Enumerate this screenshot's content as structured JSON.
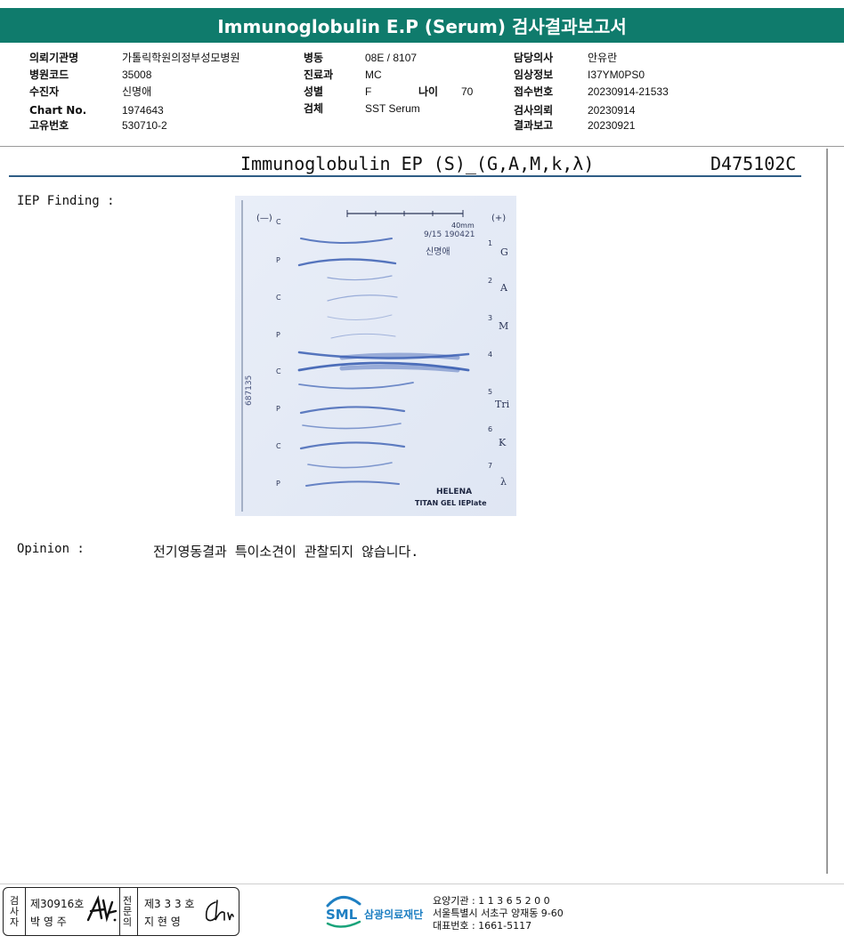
{
  "report": {
    "title": "Immunoglobulin E.P (Serum) 검사결과보고서"
  },
  "patient_info": {
    "col1": [
      {
        "label": "의뢰기관명",
        "value": "가톨릭학원의정부성모병원"
      },
      {
        "label": "병원코드",
        "value": "35008"
      },
      {
        "label": "수진자",
        "value": "신명애"
      },
      {
        "label": "Chart No.",
        "value": "1974643"
      },
      {
        "label": "고유번호",
        "value": "530710-2"
      }
    ],
    "col2": [
      {
        "label": "병동",
        "value": "08E / 8107"
      },
      {
        "label": "진료과",
        "value": "MC"
      },
      {
        "label": "성별",
        "value": "F"
      },
      {
        "label": "검체",
        "value": "SST Serum"
      }
    ],
    "age": {
      "label": "나이",
      "value": "70"
    },
    "col3": [
      {
        "label": "담당의사",
        "value": "안유란"
      },
      {
        "label": "임상정보",
        "value": "I37YM0PS0"
      },
      {
        "label": "접수번호",
        "value": "20230914-21533"
      },
      {
        "label": "검사의뢰",
        "value": "20230914"
      },
      {
        "label": "결과보고",
        "value": "20230921"
      }
    ]
  },
  "scan": {
    "title": "Immunoglobulin EP (S)_(G,A,M,k,λ)",
    "code": "D475102C",
    "finding_label": "IEP Finding :",
    "opinion_label": "Opinion :",
    "opinion_text": "전기영동결과 특이소견이 관찰되지 않습니다.",
    "gel": {
      "minus": "(—)",
      "plus": "(+)",
      "scale": "40mm",
      "date_code": "9/15 190421",
      "name": "신명애",
      "side_code": "687135",
      "well_labels": [
        "C",
        "P",
        "C",
        "P",
        "C",
        "P",
        "C",
        "P"
      ],
      "lane_numbers": [
        "1",
        "2",
        "3",
        "4",
        "5",
        "6",
        "7"
      ],
      "lane_names": [
        "G",
        "A",
        "M",
        "Tri",
        "K",
        "λ"
      ],
      "brand": "HELENA",
      "product": "TITAN GEL IEPlate"
    }
  },
  "footer": {
    "examiner_label": [
      "검",
      "사",
      "자"
    ],
    "examiner_no": "제30916호",
    "examiner_name": "박 영 주",
    "doctor_label": [
      "전",
      "문",
      "의"
    ],
    "doctor_no": "제3 3 3 호",
    "doctor_name": "지 현 영",
    "logo_text": "SML",
    "org_name": "삼광의료재단",
    "institution": "요양기관 : 1 1 3 6 5 2 0 0",
    "address": "서울특별시 서초구 양재동 9-60",
    "phone": "대표번호 : 1661-5117"
  }
}
